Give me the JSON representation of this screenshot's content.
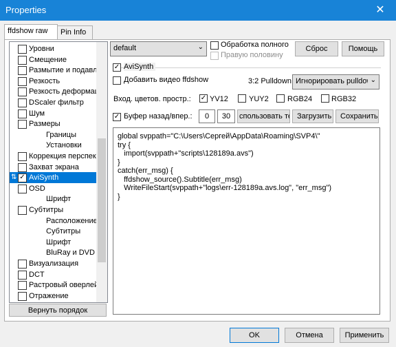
{
  "window": {
    "title": "Properties"
  },
  "tabs": [
    {
      "label": "ffdshow raw",
      "active": true
    },
    {
      "label": "Pin Info",
      "active": false
    }
  ],
  "tree": {
    "items": [
      {
        "label": "Уровни",
        "checked": false,
        "indent": 0
      },
      {
        "label": "Смещение",
        "checked": false,
        "indent": 0
      },
      {
        "label": "Размытие и подавление шума",
        "checked": false,
        "indent": 0
      },
      {
        "label": "Резкость",
        "checked": false,
        "indent": 0
      },
      {
        "label": "Резкость деформацией",
        "checked": false,
        "indent": 0
      },
      {
        "label": "DScaler фильтр",
        "checked": false,
        "indent": 0
      },
      {
        "label": "Шум",
        "checked": false,
        "indent": 0
      },
      {
        "label": "Размеры",
        "checked": false,
        "indent": 0
      },
      {
        "label": "Границы",
        "checked": null,
        "indent": 1
      },
      {
        "label": "Установки",
        "checked": null,
        "indent": 1
      },
      {
        "label": "Коррекция перспективы",
        "checked": false,
        "indent": 0
      },
      {
        "label": "Захват экрана",
        "checked": false,
        "indent": 0
      },
      {
        "label": "AviSynth",
        "checked": true,
        "indent": 0,
        "selected": true
      },
      {
        "label": "OSD",
        "checked": false,
        "indent": 0
      },
      {
        "label": "Шрифт",
        "checked": null,
        "indent": 1
      },
      {
        "label": "Субтитры",
        "checked": false,
        "indent": 0
      },
      {
        "label": "Расположение",
        "checked": null,
        "indent": 1
      },
      {
        "label": "Субтитры",
        "checked": null,
        "indent": 1
      },
      {
        "label": "Шрифт",
        "checked": null,
        "indent": 1
      },
      {
        "label": "BluRay и DVD",
        "checked": null,
        "indent": 1
      },
      {
        "label": "Визуализация",
        "checked": false,
        "indent": 0
      },
      {
        "label": "DCT",
        "checked": false,
        "indent": 0
      },
      {
        "label": "Растровый оверлей",
        "checked": false,
        "indent": 0
      },
      {
        "label": "Отражение",
        "checked": false,
        "indent": 0
      }
    ],
    "restore_order_label": "Вернуть порядок"
  },
  "preset": {
    "value": "default"
  },
  "process_full": {
    "label": "Обработка полного",
    "checked": false
  },
  "right_half": {
    "label": "Правую половину",
    "checked": false,
    "disabled": true
  },
  "reset_label": "Сброс",
  "help_label": "Помощь",
  "avisynth": {
    "enabled_label": "AviSynth",
    "enabled": true,
    "add_video_label": "Добавить видео ffdshow",
    "add_video": false,
    "pulldown_label": "3:2 Pulldown",
    "pulldown_value": "Игнорировать pulldown",
    "colorspace_label": "Вход. цветов. простр.:",
    "colorspaces": [
      {
        "label": "YV12",
        "checked": true
      },
      {
        "label": "YUY2",
        "checked": false
      },
      {
        "label": "RGB24",
        "checked": false
      },
      {
        "label": "RGB32",
        "checked": false
      }
    ],
    "buffer_label": "Буфер назад/впер.:",
    "buffer": true,
    "buffer_back": "0",
    "buffer_forward": "30",
    "use_current_label": "спользовать текущий",
    "load_label": "Загрузить",
    "save_label": "Сохранить",
    "script": "global svppath=\"C:\\Users\\Сергей\\AppData\\Roaming\\SVP4\\\"\ntry {\n   import(svppath+\"scripts\\128189a.avs\")\n}\ncatch(err_msg) {\n   ffdshow_source().Subtitle(err_msg)\n   WriteFileStart(svppath+\"logs\\err-128189a.avs.log\", \"err_msg\")\n}"
  },
  "footer": {
    "ok_label": "OK",
    "cancel_label": "Отмена",
    "apply_label": "Применить"
  }
}
